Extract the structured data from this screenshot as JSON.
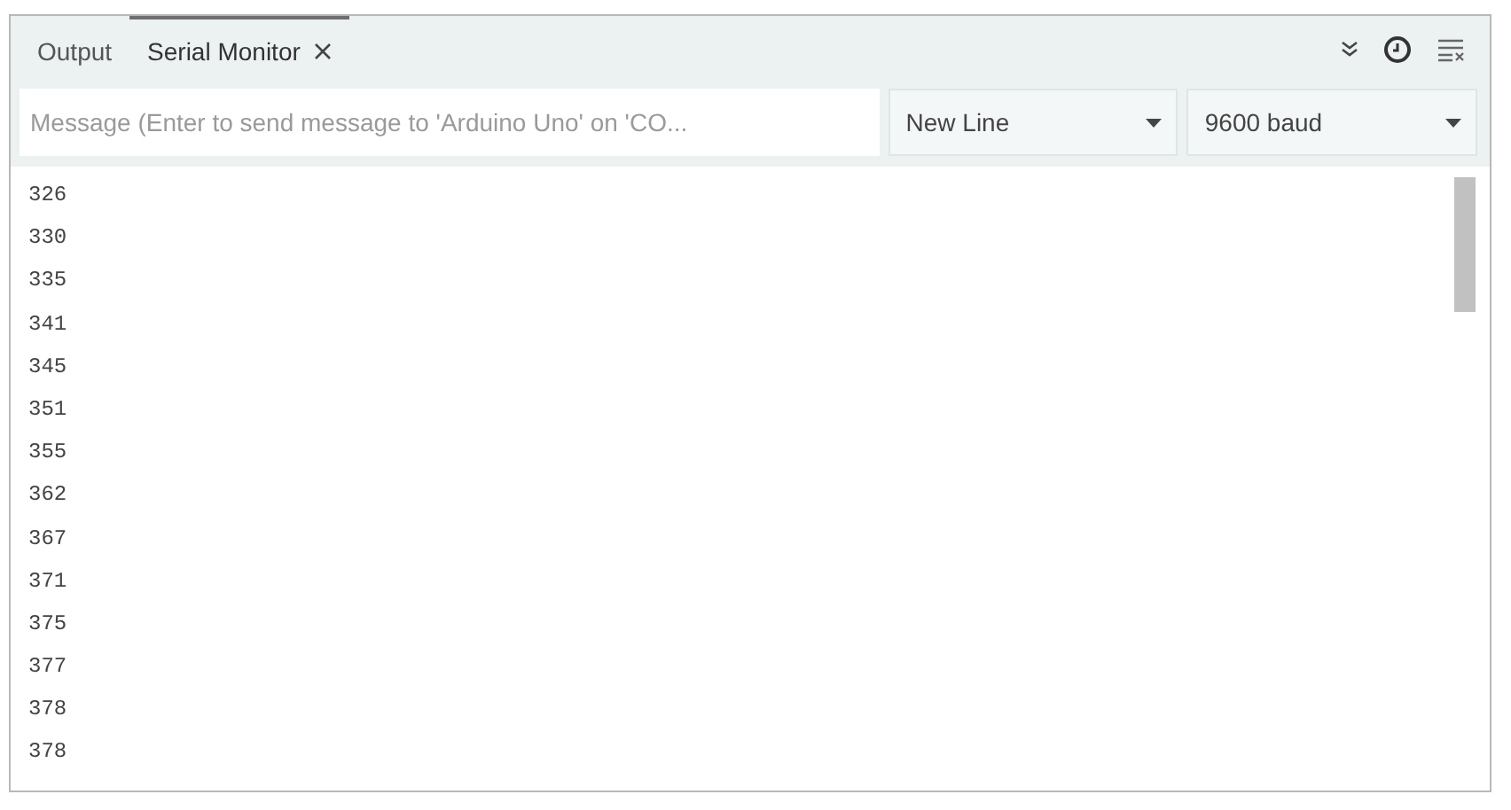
{
  "tabs": [
    {
      "label": "Output",
      "selected": false
    },
    {
      "label": "Serial Monitor",
      "selected": true
    }
  ],
  "message_field": {
    "placeholder": "Message (Enter to send message to 'Arduino Uno' on 'CO..."
  },
  "line_ending": {
    "value": "New Line"
  },
  "baud_rate": {
    "value": "9600 baud"
  },
  "output_lines": [
    "326",
    "330",
    "335",
    "341",
    "345",
    "351",
    "355",
    "362",
    "367",
    "371",
    "375",
    "377",
    "378",
    "378"
  ]
}
